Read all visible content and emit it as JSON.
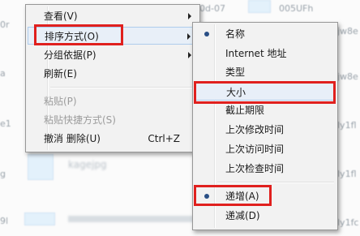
{
  "background": {
    "fragments": [
      "0r",
      "a",
      "e1",
      "g",
      "9l",
      "0d-07",
      "005UFh",
      "jw8e",
      "jw8e",
      "ly1fl",
      "ly1fl",
      "ly1fc"
    ],
    "caption": "kagejpg"
  },
  "context_menu": {
    "items": [
      {
        "label": "查看(V)",
        "submenu": true
      },
      {
        "label": "排序方式(O)",
        "submenu": true
      },
      {
        "label": "分组依据(P)",
        "submenu": true
      },
      {
        "label": "刷新(E)"
      },
      {
        "label": "粘贴(P)",
        "disabled": true
      },
      {
        "label": "粘贴快捷方式(S)",
        "disabled": true
      },
      {
        "label": "撤消 删除(U)",
        "shortcut": "Ctrl+Z"
      }
    ]
  },
  "sort_submenu": {
    "items": [
      {
        "label": "名称",
        "selected": true
      },
      {
        "label": "Internet 地址"
      },
      {
        "label": "类型"
      },
      {
        "label": "大小"
      },
      {
        "label": "截止期限"
      },
      {
        "label": "上次修改时间"
      },
      {
        "label": "上次访问时间"
      },
      {
        "label": "上次检查时间"
      },
      {
        "label": "递增(A)",
        "selected": true
      },
      {
        "label": "递减(D)"
      }
    ]
  },
  "colors": {
    "highlight": "#e0201e",
    "menu_bg": "#f2f2f2",
    "bullet": "#2a4f85"
  }
}
